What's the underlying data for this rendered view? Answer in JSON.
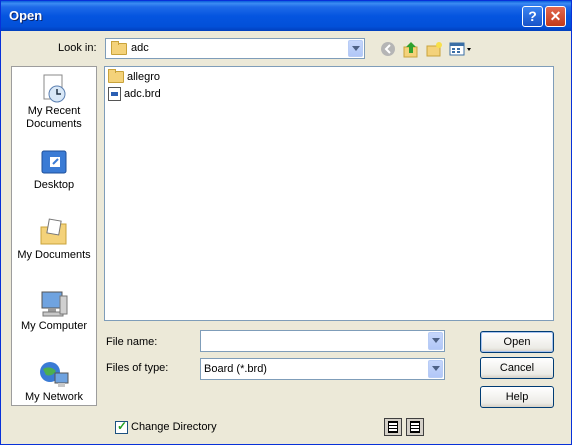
{
  "window": {
    "title": "Open",
    "help_label": "?",
    "close_label": "✕"
  },
  "look_in": {
    "label": "Look in:",
    "value": "adc"
  },
  "places": [
    {
      "label": "My Recent Documents",
      "icon": "recent-documents-icon"
    },
    {
      "label": "Desktop",
      "icon": "desktop-icon"
    },
    {
      "label": "My Documents",
      "icon": "my-documents-icon"
    },
    {
      "label": "My Computer",
      "icon": "my-computer-icon"
    },
    {
      "label": "My Network",
      "icon": "my-network-icon"
    }
  ],
  "files": [
    {
      "name": "allegro",
      "type": "folder"
    },
    {
      "name": "adc.brd",
      "type": "file"
    }
  ],
  "file_name": {
    "label": "File name:",
    "value": ""
  },
  "file_type": {
    "label": "Files of type:",
    "value": "Board (*.brd)"
  },
  "buttons": {
    "open": "Open",
    "cancel": "Cancel",
    "help": "Help"
  },
  "change_directory": {
    "label": "Change Directory",
    "checked": true
  },
  "colors": {
    "titlebar": "#0555e0",
    "dialog_bg": "#ece9d8",
    "border": "#7f9db9"
  }
}
